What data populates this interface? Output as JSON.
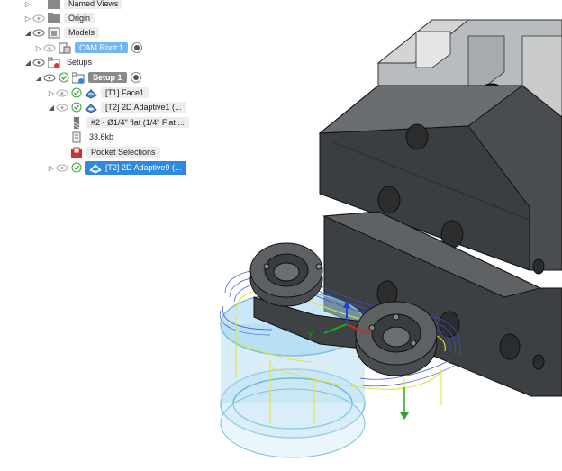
{
  "browser": {
    "named_views": "Named Views",
    "origin": "Origin",
    "models": "Models",
    "cam_root": "CAM Root:1",
    "setups": "Setups",
    "setup1": "Setup 1",
    "op_face1": "[T1] Face1",
    "op_adaptive1": "[T2] 2D Adaptive1 (...",
    "tool_desc": "#2 - Ø1/4\" flat (1/4\" Flat ...",
    "file_size": "33.6kb",
    "pocket_selections": "Pocket Selections",
    "op_adaptive9": "[T2] 2D Adaptive9 (..."
  },
  "viewcube_axes": {
    "x": "X",
    "y": "Y"
  },
  "colors": {
    "selection_blue": "#2d8ae0",
    "toolpath_blue": "#3a4fd8",
    "toolpath_yellow": "#e4e43a",
    "stock_cyan": "#9fd3ef",
    "part_dark": "#4a4d4f",
    "vise_gray": "#9ea2a4"
  }
}
